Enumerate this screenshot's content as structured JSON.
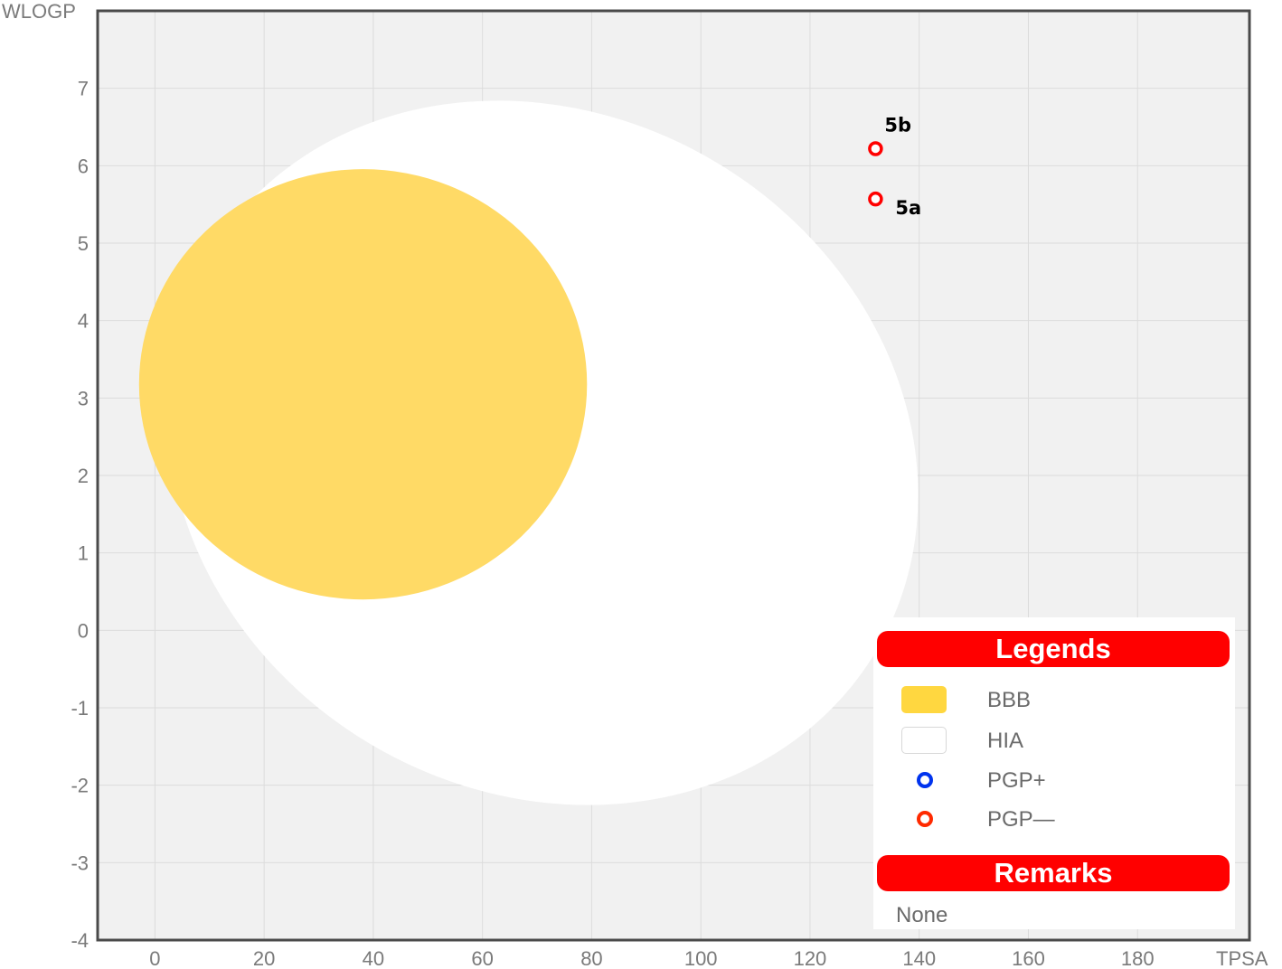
{
  "chart_data": {
    "type": "scatter",
    "xlabel": "TPSA",
    "ylabel": "WLOGP",
    "xlim": [
      -10.5,
      200.5
    ],
    "ylim": [
      -4,
      8
    ],
    "x_ticks": [
      "0",
      "20",
      "40",
      "60",
      "80",
      "100",
      "120",
      "140",
      "160",
      "180"
    ],
    "y_ticks": [
      "7",
      "6",
      "5",
      "4",
      "3",
      "2",
      "1",
      "0",
      "-1",
      "-2",
      "-3",
      "-4"
    ],
    "grid": true,
    "regions": [
      {
        "name": "HIA",
        "shape": "ellipse",
        "color": "#ffffff",
        "center": [
          71.05,
          2.292
        ],
        "rx": 142.081,
        "ry": 8.74,
        "rotation_deg": 31.03
      },
      {
        "name": "BBB",
        "shape": "ellipse",
        "color": "#ffda66",
        "center": [
          38.117,
          3.177
        ],
        "rx": 82.061,
        "ry": 5.557,
        "rotation_deg": 0
      }
    ],
    "series": [
      {
        "name": "PGP—",
        "color": "#ff0000",
        "points": [
          {
            "x": 132,
            "y": 6.22,
            "label": "5b"
          },
          {
            "x": 132,
            "y": 5.57,
            "label": "5a"
          }
        ]
      }
    ],
    "legend_position": "bottom-right",
    "legend": {
      "title": "Legends",
      "items": [
        {
          "label": "BBB",
          "kind": "swatch",
          "color": "#ffd740",
          "border": "#ffd740"
        },
        {
          "label": "HIA",
          "kind": "swatch",
          "color": "#ffffff",
          "border": "#d8d8d8"
        },
        {
          "label": "PGP+",
          "kind": "dot",
          "color": "#0033ee"
        },
        {
          "label": "PGP—",
          "kind": "dot",
          "color": "#ff2a00"
        }
      ],
      "remarks_title": "Remarks",
      "remarks": "None"
    }
  }
}
